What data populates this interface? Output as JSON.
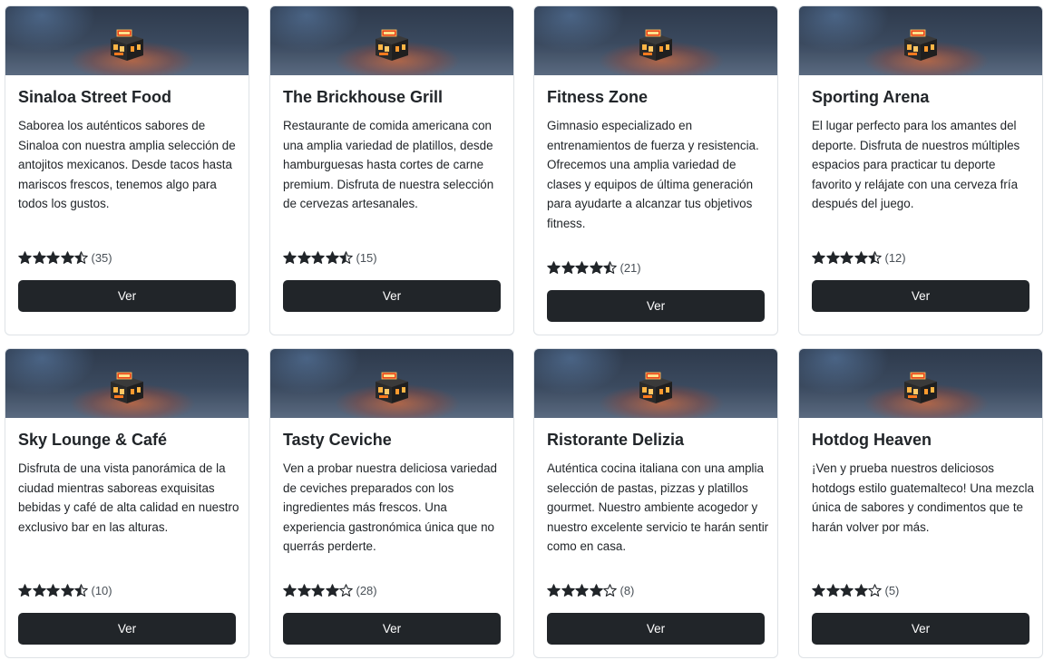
{
  "cards": [
    {
      "title": "Sinaloa Street Food",
      "description": "Saborea los auténticos sabores de Sinaloa con nuestra amplia selección de antojitos mexicanos. Desde tacos hasta mariscos frescos, tenemos algo para todos los gustos.",
      "rating": 4.5,
      "reviews": "(35)",
      "button": "Ver",
      "image_icon": "store-open-icon"
    },
    {
      "title": "The Brickhouse Grill",
      "description": "Restaurante de comida americana con una amplia variedad de platillos, desde hamburguesas hasta cortes de carne premium. Disfruta de nuestra selección de cervezas artesanales.",
      "rating": 4.5,
      "reviews": "(15)",
      "button": "Ver",
      "image_icon": "store-open-icon"
    },
    {
      "title": "Fitness Zone",
      "description": "Gimnasio especializado en entrenamientos de fuerza y resistencia. Ofrecemos una amplia variedad de clases y equipos de última generación para ayudarte a alcanzar tus objetivos fitness.",
      "rating": 4.5,
      "reviews": "(21)",
      "button": "Ver",
      "image_icon": "store-open-icon"
    },
    {
      "title": "Sporting Arena",
      "description": "El lugar perfecto para los amantes del deporte. Disfruta de nuestros múltiples espacios para practicar tu deporte favorito y relájate con una cerveza fría después del juego.",
      "rating": 4.5,
      "reviews": "(12)",
      "button": "Ver",
      "image_icon": "store-open-icon"
    },
    {
      "title": "Sky Lounge & Café",
      "description": "Disfruta de una vista panorámica de la ciudad mientras saboreas exquisitas bebidas y café de alta calidad en nuestro exclusivo bar en las alturas.",
      "rating": 4.5,
      "reviews": "(10)",
      "button": "Ver",
      "image_icon": "store-open-icon"
    },
    {
      "title": "Tasty Ceviche",
      "description": "Ven a probar nuestra deliciosa variedad de ceviches preparados con los ingredientes más frescos. Una experiencia gastronómica única que no querrás perderte.",
      "rating": 4,
      "reviews": "(28)",
      "button": "Ver",
      "image_icon": "store-open-icon"
    },
    {
      "title": "Ristorante Delizia",
      "description": "Auténtica cocina italiana con una amplia selección de pastas, pizzas y platillos gourmet. Nuestro ambiente acogedor y nuestro excelente servicio te harán sentir como en casa.",
      "rating": 4,
      "reviews": "(8)",
      "button": "Ver",
      "image_icon": "store-open-icon"
    },
    {
      "title": "Hotdog Heaven",
      "description": "¡Ven y prueba nuestros deliciosos hotdogs estilo guatemalteco! Una mezcla única de sabores y condimentos que te harán volver por más.",
      "rating": 4,
      "reviews": "(5)",
      "button": "Ver",
      "image_icon": "store-open-icon"
    }
  ],
  "colors": {
    "button_bg": "#212529",
    "button_text": "#ffffff",
    "card_border": "#dee2e6",
    "star": "#212529"
  }
}
